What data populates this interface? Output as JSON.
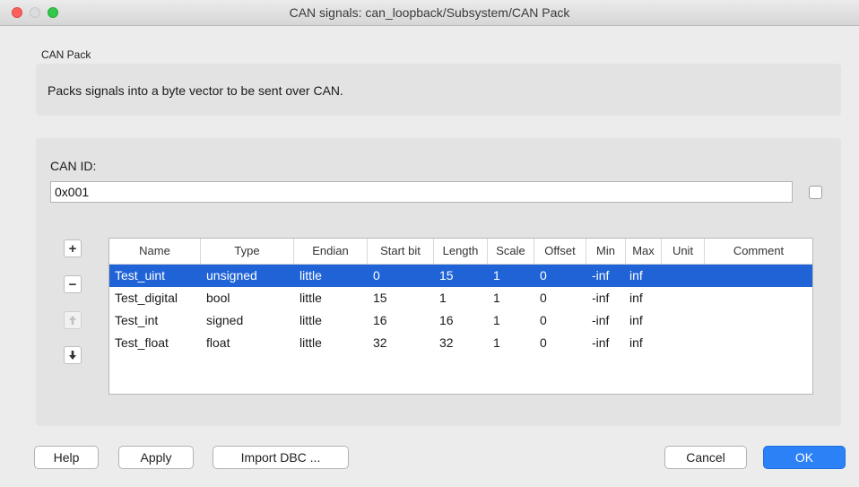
{
  "window": {
    "title": "CAN signals: can_loopback/Subsystem/CAN Pack"
  },
  "group_label": "CAN Pack",
  "description": "Packs signals into a byte vector to be sent over CAN.",
  "can_id": {
    "label": "CAN ID:",
    "value": "0x001",
    "checked": false
  },
  "side_buttons": {
    "add": "+",
    "remove": "−",
    "up": "🡅",
    "down": "🡇"
  },
  "table": {
    "columns": [
      "Name",
      "Type",
      "Endian",
      "Start bit",
      "Length",
      "Scale",
      "Offset",
      "Min",
      "Max",
      "Unit",
      "Comment"
    ],
    "rows": [
      [
        "Test_uint",
        "unsigned",
        "little",
        "0",
        "15",
        "1",
        "0",
        "-inf",
        "inf",
        "",
        ""
      ],
      [
        "Test_digital",
        "bool",
        "little",
        "15",
        "1",
        "1",
        "0",
        "-inf",
        "inf",
        "",
        ""
      ],
      [
        "Test_int",
        "signed",
        "little",
        "16",
        "16",
        "1",
        "0",
        "-inf",
        "inf",
        "",
        ""
      ],
      [
        "Test_float",
        "float",
        "little",
        "32",
        "32",
        "1",
        "0",
        "-inf",
        "inf",
        "",
        ""
      ]
    ],
    "selected_row": 0
  },
  "buttons": {
    "help": "Help",
    "apply": "Apply",
    "import": "Import DBC ...",
    "cancel": "Cancel",
    "ok": "OK"
  }
}
